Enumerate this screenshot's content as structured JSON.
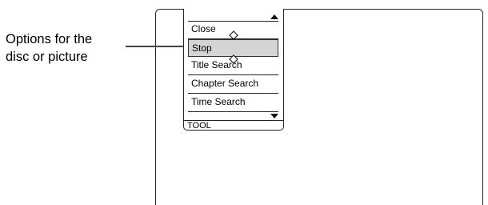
{
  "callout": {
    "line1": "Options for the",
    "line2": "disc or picture"
  },
  "menu": {
    "items": [
      {
        "label": "Close",
        "selected": false
      },
      {
        "label": "Stop",
        "selected": true
      },
      {
        "label": "Title Search",
        "selected": false
      },
      {
        "label": "Chapter Search",
        "selected": false
      },
      {
        "label": "Time Search",
        "selected": false
      }
    ],
    "footer": "TOOL",
    "scroll_up_icon": "triangle-up-icon",
    "scroll_down_icon": "triangle-down-icon",
    "cursor_icon": "up-down-cursor-icon"
  }
}
